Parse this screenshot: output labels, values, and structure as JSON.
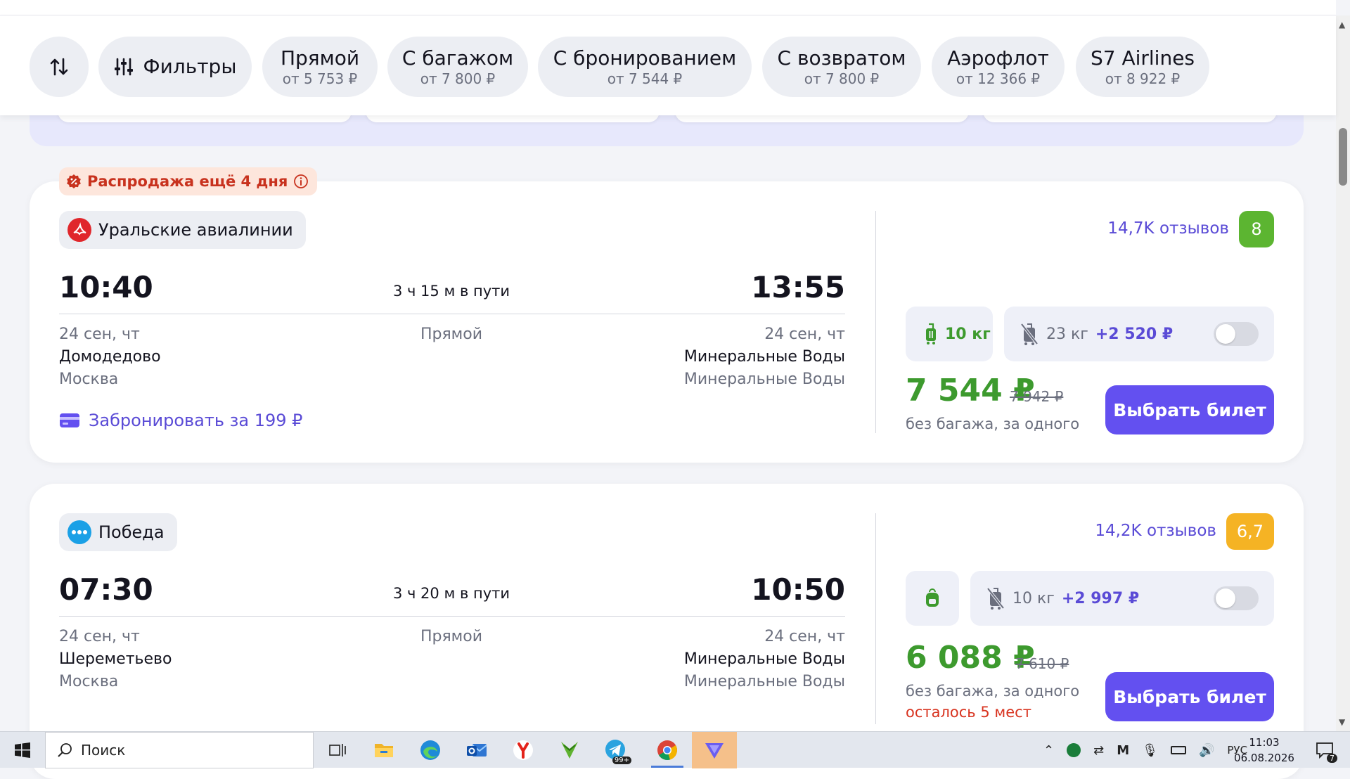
{
  "filters": {
    "sort_label": "Сортировка",
    "filters_label": "Фильтры",
    "chips": [
      {
        "title": "Прямой",
        "sub": "от 5 753 ₽"
      },
      {
        "title": "С багажом",
        "sub": "от 7 800 ₽"
      },
      {
        "title": "С бронированием",
        "sub": "от 7 544 ₽"
      },
      {
        "title": "С возвратом",
        "sub": "от 7 800 ₽"
      },
      {
        "title": "Аэрофлот",
        "sub": "от 12 366 ₽"
      },
      {
        "title": "S7 Airlines",
        "sub": "от 8 922 ₽"
      }
    ]
  },
  "flights": [
    {
      "sale_badge": "Распродажа ещё 4 дня",
      "airline": "Уральские авиалинии",
      "reviews": "14,7K отзывов",
      "rating": "8",
      "rating_color": "#5cb531",
      "depart_time": "10:40",
      "arrive_time": "13:55",
      "duration": "3 ч 15 м в пути",
      "stops": "Прямой",
      "depart_date": "24 сен, чт",
      "arrive_date": "24 сен, чт",
      "depart_airport": "Домодедово",
      "arrive_airport": "Минеральные Воды",
      "depart_city": "Москва",
      "arrive_city": "Минеральные Воды",
      "book_label": "Забронировать за 199 ₽",
      "hand_bag": "10 кг",
      "checked_bag": "23 кг",
      "checked_bag_price": "+2 520 ₽",
      "baggage_toggle_on": false,
      "price": "7 544 ₽",
      "old_price": "7 942 ₽",
      "price_note": "без багажа, за одного",
      "select_label": "Выбрать билет"
    },
    {
      "airline": "Победа",
      "reviews": "14,2K отзывов",
      "rating": "6,7",
      "rating_color": "#f5b324",
      "depart_time": "07:30",
      "arrive_time": "10:50",
      "duration": "3 ч 20 м в пути",
      "stops": "Прямой",
      "depart_date": "24 сен, чт",
      "arrive_date": "24 сен, чт",
      "depart_airport": "Шереметьево",
      "arrive_airport": "Минеральные Воды",
      "depart_city": "Москва",
      "arrive_city": "Минеральные Воды",
      "checked_bag": "10 кг",
      "checked_bag_price": "+2 997 ₽",
      "baggage_toggle_on": false,
      "price": "6 088 ₽",
      "old_price": "7 610 ₽",
      "price_note": "без багажа, за одного",
      "seats_left": "осталось 5 мест",
      "select_label": "Выбрать билет"
    }
  ],
  "taskbar": {
    "search_placeholder": "Поиск",
    "lang": "РУС",
    "time": "11:03",
    "date": "06.08.2026",
    "notifications": "7",
    "telegram_badge": "99+"
  },
  "colors": {
    "accent": "#6350f0",
    "price_green": "#3d9a2e",
    "link": "#5a4bd6",
    "sale_red": "#c8321e"
  }
}
